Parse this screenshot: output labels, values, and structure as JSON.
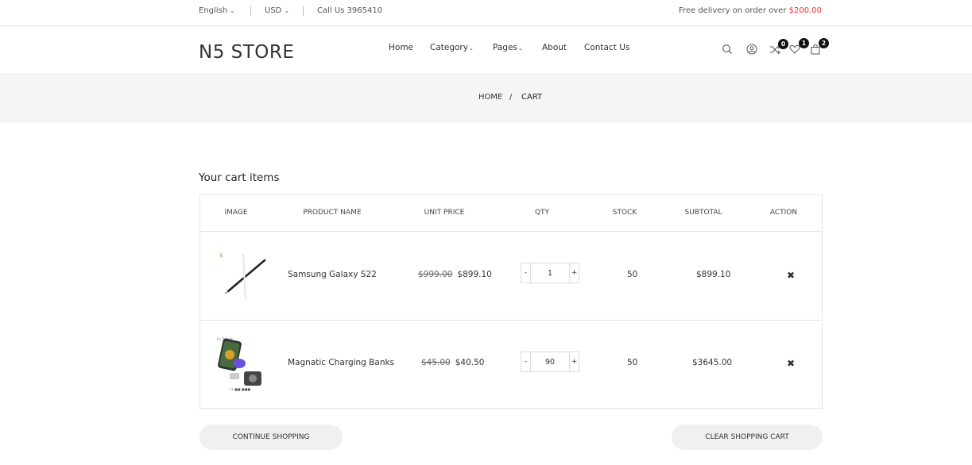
{
  "topbar": {
    "language": "English",
    "currency": "USD",
    "phone": "Call Us 3965410",
    "delivery_text": "Free delivery on order over",
    "delivery_amount": "$200.00"
  },
  "header": {
    "logo": "N5 STORE",
    "nav": [
      "Home",
      "Category",
      "Pages",
      "About",
      "Contact Us"
    ],
    "compare_count": "0",
    "wishlist_count": "1",
    "cart_count": "2"
  },
  "breadcrumb": {
    "home": "HOME",
    "separator": "/",
    "current": "CART"
  },
  "cart": {
    "title": "Your cart items",
    "columns": [
      "IMAGE",
      "PRODUCT NAME",
      "UNIT PRICE",
      "QTY",
      "STOCK",
      "SUBTOTAL",
      "ACTION"
    ],
    "items": [
      {
        "name": "Samsung Galaxy S22",
        "old_price": "$999.00",
        "price": "$899.10",
        "qty": "1",
        "stock": "50",
        "subtotal": "$899.10",
        "image_icon": "stylus-pen-image"
      },
      {
        "name": "Magnatic Charging Banks",
        "old_price": "$45.00",
        "price": "$40.50",
        "qty": "90",
        "stock": "50",
        "subtotal": "$3645.00",
        "image_icon": "charging-stand-image"
      }
    ],
    "qty_minus": "-",
    "qty_plus": "+",
    "remove_icon": "✖",
    "continue_label": "CONTINUE SHOPPING",
    "clear_label": "CLEAR SHOPPING CART"
  },
  "colors": {
    "accent_red": "#e33333",
    "band_gray": "#f5f5f5",
    "badge": "#111111"
  }
}
